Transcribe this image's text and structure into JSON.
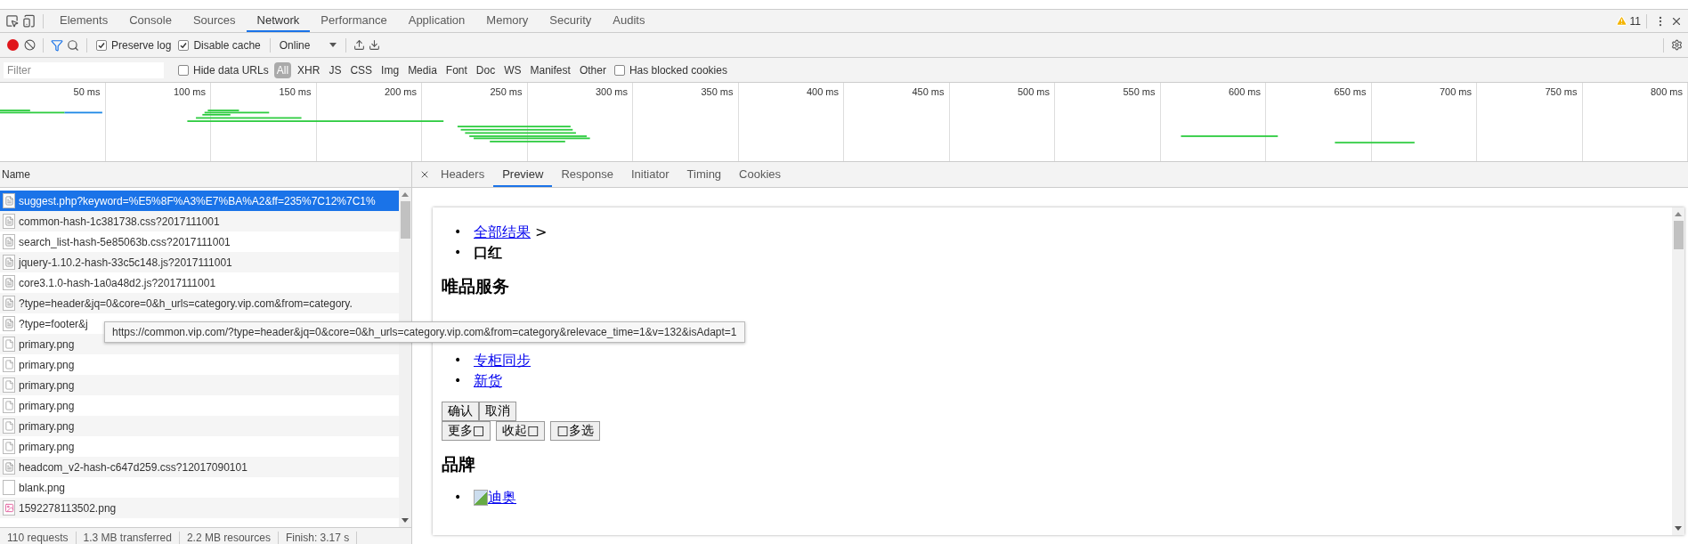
{
  "top_tabs": [
    {
      "label": "Elements",
      "selected": false
    },
    {
      "label": "Console",
      "selected": false
    },
    {
      "label": "Sources",
      "selected": false
    },
    {
      "label": "Network",
      "selected": true
    },
    {
      "label": "Performance",
      "selected": false
    },
    {
      "label": "Application",
      "selected": false
    },
    {
      "label": "Memory",
      "selected": false
    },
    {
      "label": "Security",
      "selected": false
    },
    {
      "label": "Audits",
      "selected": false
    }
  ],
  "warnings": "11",
  "toolbar": {
    "recording": true,
    "filter_active": true,
    "preserve_log": {
      "label": "Preserve log",
      "checked": true
    },
    "disable_cache": {
      "label": "Disable cache",
      "checked": true
    },
    "throttling": "Online"
  },
  "filter_bar": {
    "placeholder": "Filter",
    "hide_data_urls": {
      "label": "Hide data URLs",
      "checked": false
    },
    "types": [
      {
        "label": "All",
        "selected": true
      },
      {
        "label": "XHR",
        "selected": false
      },
      {
        "label": "JS",
        "selected": false
      },
      {
        "label": "CSS",
        "selected": false
      },
      {
        "label": "Img",
        "selected": false
      },
      {
        "label": "Media",
        "selected": false
      },
      {
        "label": "Font",
        "selected": false
      },
      {
        "label": "Doc",
        "selected": false
      },
      {
        "label": "WS",
        "selected": false
      },
      {
        "label": "Manifest",
        "selected": false
      },
      {
        "label": "Other",
        "selected": false
      }
    ],
    "blocked_cookies": {
      "label": "Has blocked cookies",
      "checked": false
    }
  },
  "timeline": {
    "ticks": [
      "50 ms",
      "100 ms",
      "150 ms",
      "200 ms",
      "250 ms",
      "300 ms",
      "350 ms",
      "400 ms",
      "450 ms",
      "500 ms",
      "550 ms",
      "600 ms",
      "650 ms",
      "700 ms",
      "750 ms",
      "800 ms"
    ]
  },
  "requests": {
    "header": "Name",
    "rows": [
      {
        "name": "suggest.php?keyword=%E5%8F%A3%E7%BA%A2&ff=235%7C12%7C1%",
        "kind": "doc",
        "selected": true
      },
      {
        "name": "common-hash-1c381738.css?2017111001",
        "kind": "doc",
        "selected": false
      },
      {
        "name": "search_list-hash-5e85063b.css?2017111001",
        "kind": "doc",
        "selected": false
      },
      {
        "name": "jquery-1.10.2-hash-33c5c148.js?2017111001",
        "kind": "doc",
        "selected": false
      },
      {
        "name": "core3.1.0-hash-1a0a48d2.js?2017111001",
        "kind": "doc",
        "selected": false
      },
      {
        "name": "?type=header&jq=0&core=0&h_urls=category.vip.com&from=category.",
        "kind": "doc",
        "selected": false
      },
      {
        "name": "?type=footer&j",
        "kind": "doc",
        "selected": false
      },
      {
        "name": "primary.png",
        "kind": "image",
        "selected": false
      },
      {
        "name": "primary.png",
        "kind": "image",
        "selected": false
      },
      {
        "name": "primary.png",
        "kind": "image",
        "selected": false
      },
      {
        "name": "primary.png",
        "kind": "image",
        "selected": false
      },
      {
        "name": "primary.png",
        "kind": "image",
        "selected": false
      },
      {
        "name": "primary.png",
        "kind": "image",
        "selected": false
      },
      {
        "name": "headcom_v2-hash-c647d259.css?12017090101",
        "kind": "doc",
        "selected": false
      },
      {
        "name": "blank.png",
        "kind": "blank",
        "selected": false
      },
      {
        "name": "1592278113502.png",
        "kind": "picture",
        "selected": false
      }
    ]
  },
  "status": [
    "110 requests",
    "1.3 MB transferred",
    "2.2 MB resources",
    "Finish: 3.17 s"
  ],
  "tooltip": "https://common.vip.com/?type=header&jq=0&core=0&h_urls=category.vip.com&from=category&relevace_time=1&v=132&isAdapt=1",
  "detail_tabs": [
    {
      "label": "Headers",
      "selected": false
    },
    {
      "label": "Preview",
      "selected": true
    },
    {
      "label": "Response",
      "selected": false
    },
    {
      "label": "Initiator",
      "selected": false
    },
    {
      "label": "Timing",
      "selected": false
    },
    {
      "label": "Cookies",
      "selected": false
    }
  ],
  "preview": {
    "bullet": "•",
    "breadcrumb_link": "全部结果",
    "breadcrumb_separator": ">",
    "breadcrumb_current": "口红",
    "service_heading": "唯品服务",
    "service_links": [
      "专柜同步",
      "新货"
    ],
    "buttons_row_1": [
      "确认",
      "取消"
    ],
    "buttons_row_2": [
      "更多□",
      "收起□",
      "□多选"
    ],
    "brand_heading": "品牌",
    "brands": [
      "迪奥"
    ]
  }
}
